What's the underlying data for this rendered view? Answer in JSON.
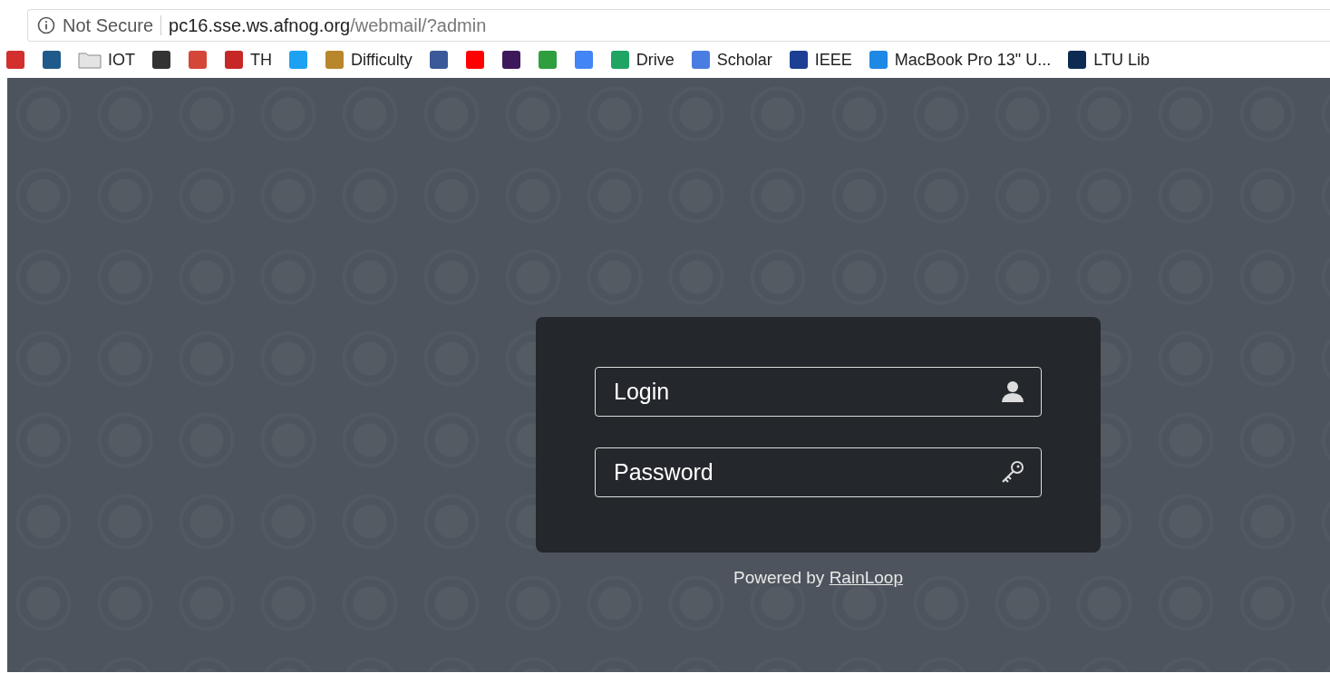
{
  "address_bar": {
    "security": "Not Secure",
    "host": "pc16.sse.ws.afnog.org",
    "path": "/webmail/?admin"
  },
  "bookmarks": [
    {
      "kind": "site",
      "color": "#d32f2f"
    },
    {
      "kind": "site",
      "color": "#1f5a8a"
    },
    {
      "kind": "folder",
      "label": "IOT"
    },
    {
      "kind": "site",
      "color": "#333333"
    },
    {
      "kind": "site",
      "color": "#d44638"
    },
    {
      "kind": "site",
      "color": "#c62828",
      "label": "TH"
    },
    {
      "kind": "site",
      "color": "#1da1f2"
    },
    {
      "kind": "site",
      "color": "#b8862b",
      "label": "Difficulty"
    },
    {
      "kind": "site",
      "color": "#3b5998"
    },
    {
      "kind": "site",
      "color": "#ff0000"
    },
    {
      "kind": "site",
      "color": "#3d195b"
    },
    {
      "kind": "site",
      "color": "#2e9e3e"
    },
    {
      "kind": "site",
      "color": "#4285f4"
    },
    {
      "kind": "site",
      "color": "#1fa463",
      "label": "Drive"
    },
    {
      "kind": "site",
      "color": "#4a7de2",
      "label": "Scholar"
    },
    {
      "kind": "site",
      "color": "#1c3f94",
      "label": "IEEE"
    },
    {
      "kind": "site",
      "color": "#1e88e5",
      "label": "MacBook Pro 13\" U..."
    },
    {
      "kind": "site",
      "color": "#0d2b52",
      "label": "LTU Lib"
    }
  ],
  "login": {
    "login_placeholder": "Login",
    "password_placeholder": "Password",
    "footer_text": "Powered by",
    "footer_link": "RainLoop"
  }
}
